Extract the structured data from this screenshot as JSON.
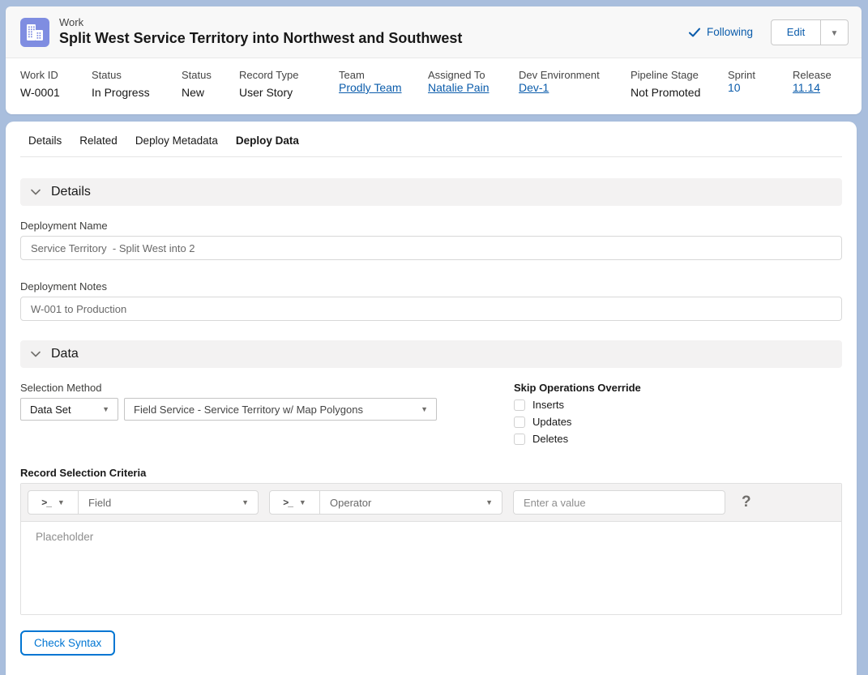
{
  "colors": {
    "page_background": "#a9bedd",
    "link": "#0b5cab",
    "button_blue": "#0176d3",
    "work_icon_background": "#7f8de1",
    "section_bar_background": "#f3f2f2"
  },
  "header": {
    "entity": "Work",
    "title": "Split West Service Territory into Northwest and Southwest",
    "following_label": "Following",
    "edit_label": "Edit"
  },
  "fields": [
    {
      "label": "Work ID",
      "value": "W-0001"
    },
    {
      "label": "Status",
      "value": "In Progress"
    },
    {
      "label": "Status",
      "value": "New"
    },
    {
      "label": "Record Type",
      "value": "User Story"
    },
    {
      "label": "Team",
      "value": "Prodly Team"
    },
    {
      "label": "Assigned To",
      "value": "Natalie Pain"
    },
    {
      "label": "Dev Environment",
      "value": "Dev-1"
    },
    {
      "label": "Pipeline Stage",
      "value": "Not Promoted"
    },
    {
      "label": "Sprint",
      "value": "10"
    },
    {
      "label": "Release",
      "value": "11.14"
    }
  ],
  "tabs": [
    {
      "label": "Details",
      "active": false
    },
    {
      "label": "Related",
      "active": false
    },
    {
      "label": "Deploy Metadata",
      "active": false
    },
    {
      "label": "Deploy Data",
      "active": true
    }
  ],
  "details_section": {
    "title": "Details",
    "deployment_name_label": "Deployment Name",
    "deployment_name_value": "Service Territory  - Split West into 2",
    "deployment_notes_label": "Deployment Notes",
    "deployment_notes_value": "W-001 to Production"
  },
  "data_section": {
    "title": "Data",
    "selection_method_label": "Selection Method",
    "selection_method_value": "Data Set",
    "data_set_value": "Field Service - Service Territory w/ Map Polygons",
    "skip_operations_label": "Skip Operations Override",
    "skip_operations_options": [
      "Inserts",
      "Updates",
      "Deletes"
    ],
    "criteria_label": "Record Selection Criteria",
    "field_placeholder": "Field",
    "operator_placeholder": "Operator",
    "value_placeholder": "Enter a value",
    "editor_placeholder": "Placeholder",
    "help_glyph": "?",
    "check_syntax_label": "Check Syntax"
  }
}
